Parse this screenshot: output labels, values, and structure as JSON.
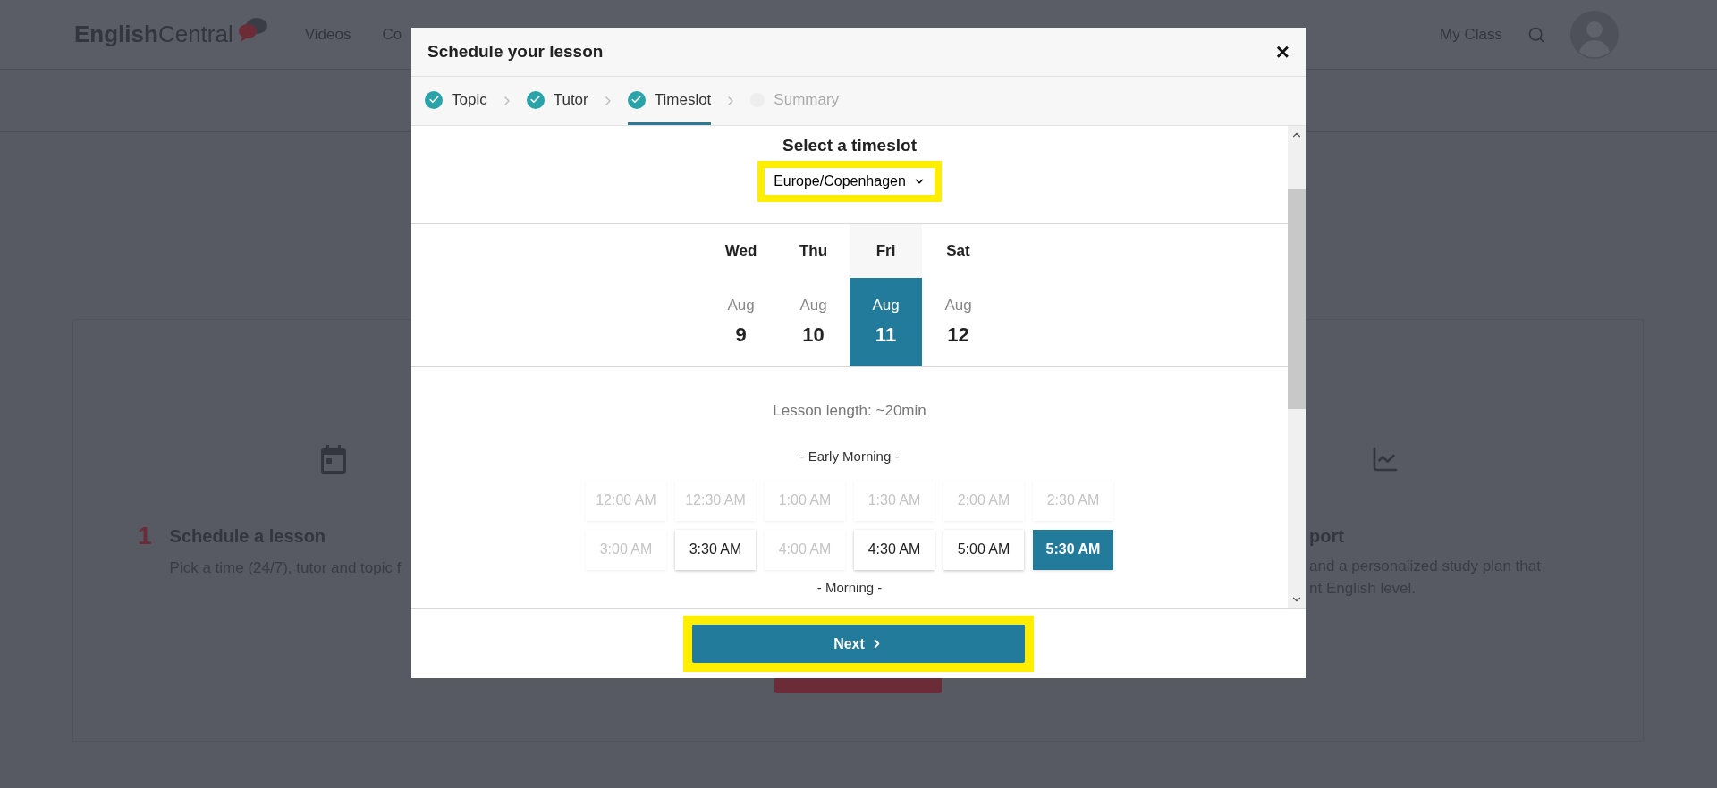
{
  "nav": {
    "logo": "**English**Central",
    "links": [
      "Videos",
      "Co"
    ],
    "right_link": "My Class"
  },
  "background": {
    "left_step": {
      "number": "1",
      "title": "Schedule a lesson",
      "text": "Pick a time (24/7), tutor and topic f"
    },
    "right_step": {
      "title": "port",
      "lines": [
        "and a personalized study plan that",
        "nt English level."
      ]
    }
  },
  "modal": {
    "title": "Schedule your lesson",
    "close": "×",
    "steps": [
      {
        "label": "Topic",
        "done": true,
        "selected": false
      },
      {
        "label": "Tutor",
        "done": true,
        "selected": false
      },
      {
        "label": "Timeslot",
        "done": true,
        "selected": true
      },
      {
        "label": "Summary",
        "done": false,
        "selected": false
      }
    ],
    "heading": "Select a timeslot",
    "timezone": {
      "value": "Europe/Copenhagen",
      "highlighted": true
    },
    "days": [
      {
        "weekday": "Wed",
        "month": "Aug",
        "day": "9",
        "selected": false
      },
      {
        "weekday": "Thu",
        "month": "Aug",
        "day": "10",
        "selected": false
      },
      {
        "weekday": "Fri",
        "month": "Aug",
        "day": "11",
        "selected": true
      },
      {
        "weekday": "Sat",
        "month": "Aug",
        "day": "12",
        "selected": false
      }
    ],
    "lesson_length": "Lesson length: ~20min",
    "sections": [
      {
        "title": "- Early Morning -",
        "slots": [
          {
            "label": "12:00 AM",
            "disabled": true,
            "selected": false
          },
          {
            "label": "12:30 AM",
            "disabled": true,
            "selected": false
          },
          {
            "label": "1:00 AM",
            "disabled": true,
            "selected": false
          },
          {
            "label": "1:30 AM",
            "disabled": true,
            "selected": false
          },
          {
            "label": "2:00 AM",
            "disabled": true,
            "selected": false
          },
          {
            "label": "2:30 AM",
            "disabled": true,
            "selected": false
          },
          {
            "label": "3:00 AM",
            "disabled": true,
            "selected": false
          },
          {
            "label": "3:30 AM",
            "disabled": false,
            "selected": false
          },
          {
            "label": "4:00 AM",
            "disabled": true,
            "selected": false
          },
          {
            "label": "4:30 AM",
            "disabled": false,
            "selected": false
          },
          {
            "label": "5:00 AM",
            "disabled": false,
            "selected": false
          },
          {
            "label": "5:30 AM",
            "disabled": false,
            "selected": true
          }
        ]
      },
      {
        "title": "- Morning -"
      }
    ],
    "next_button": {
      "label": "Next",
      "highlighted": true
    }
  }
}
